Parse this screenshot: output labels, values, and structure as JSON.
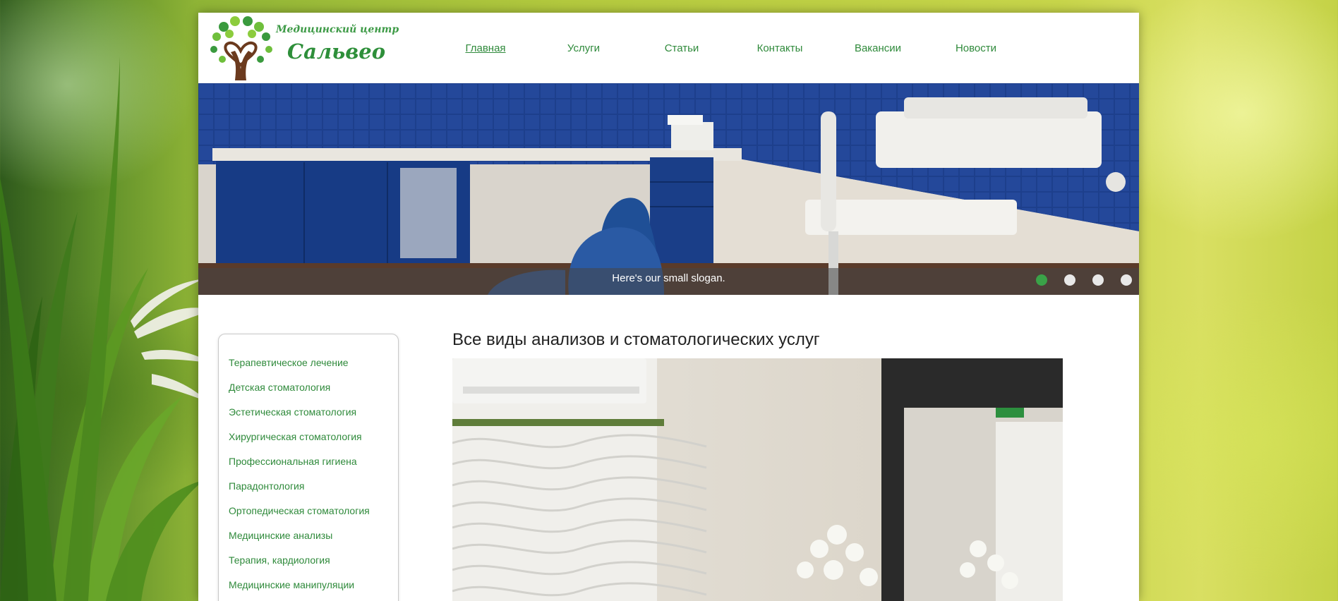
{
  "logo": {
    "line1": "Медицинский центр",
    "line2": "Сальвео"
  },
  "nav": {
    "items": [
      {
        "label": "Главная",
        "active": true
      },
      {
        "label": "Услуги",
        "active": false
      },
      {
        "label": "Статьи",
        "active": false
      },
      {
        "label": "Контакты",
        "active": false
      },
      {
        "label": "Вакансии",
        "active": false
      },
      {
        "label": "Новости",
        "active": false
      }
    ]
  },
  "slider": {
    "slogan": "Here's our small slogan.",
    "slide_count": 4,
    "active_slide": 1
  },
  "sidebar": {
    "items": [
      "Терапевтическое лечение",
      "Детская стоматология",
      "Эстетическая стоматология",
      "Хирургическая стоматология",
      "Профессиональная гигиена",
      "Парадонтология",
      "Ортопедическая стоматология",
      "Медицинские анализы",
      "Терапия, кардиология",
      "Медицинские манипуляции"
    ]
  },
  "content": {
    "title": "Все виды анализов и стоматологических услуг"
  },
  "colors": {
    "accent_green": "#2f8a3b",
    "active_dot": "#3aa248",
    "tile_blue": "#1c3d88"
  }
}
